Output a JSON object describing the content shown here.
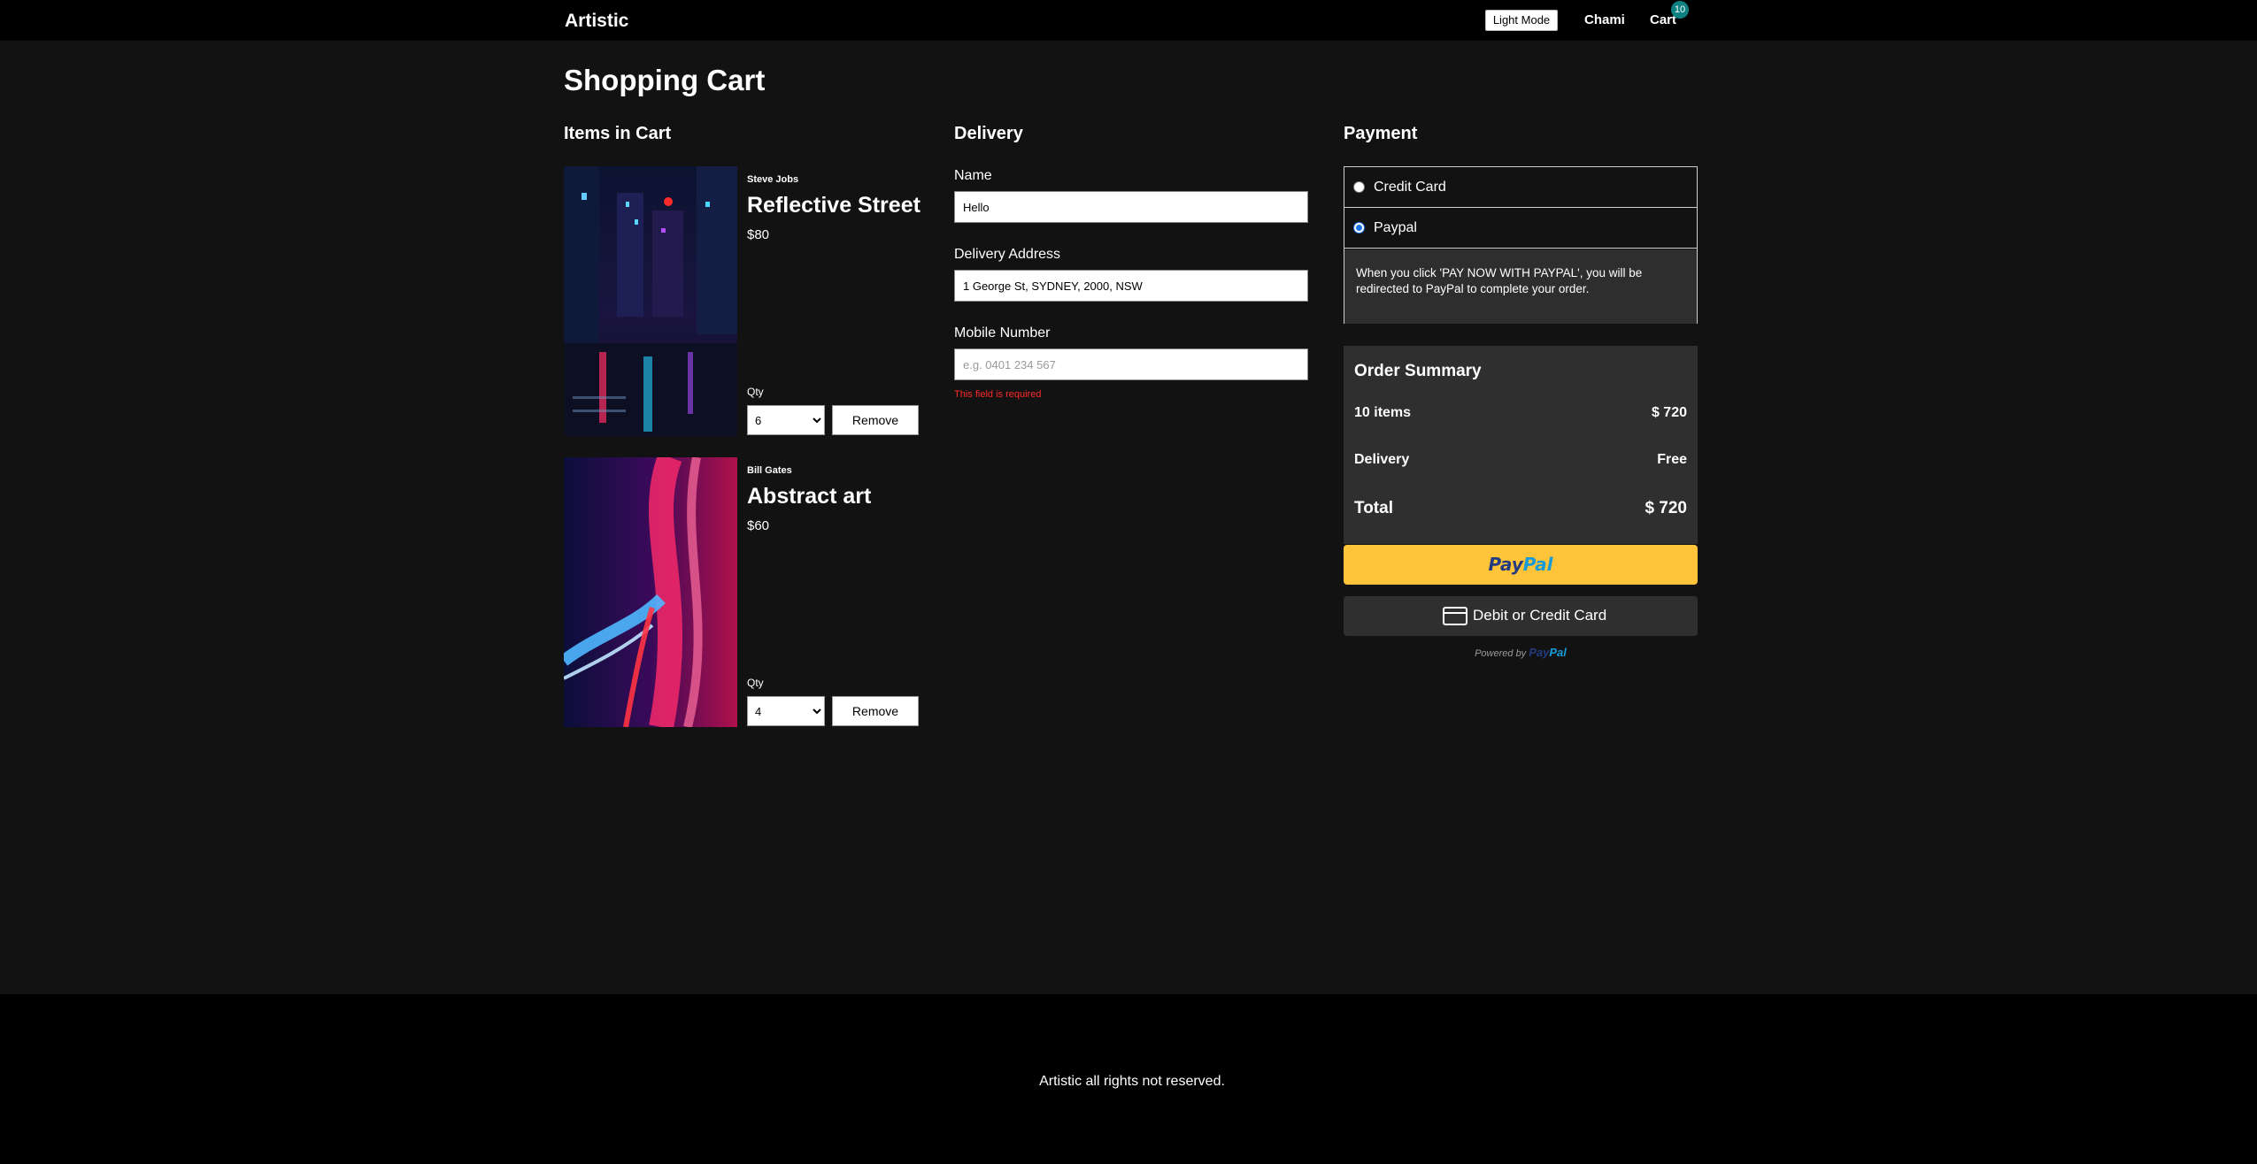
{
  "header": {
    "brand": "Artistic",
    "mode_button": "Light Mode",
    "user": "Chami",
    "cart_label": "Cart",
    "cart_count": "10"
  },
  "page_title": "Shopping Cart",
  "cart": {
    "heading": "Items in Cart",
    "qty_label": "Qty",
    "remove_label": "Remove",
    "items": [
      {
        "artist": "Steve Jobs",
        "title": "Reflective Street",
        "price": "$80",
        "qty": "6"
      },
      {
        "artist": "Bill Gates",
        "title": "Abstract art",
        "price": "$60",
        "qty": "4"
      }
    ]
  },
  "delivery": {
    "heading": "Delivery",
    "name_label": "Name",
    "name_value": "Hello",
    "address_label": "Delivery Address",
    "address_value": "1 George St, SYDNEY, 2000, NSW",
    "mobile_label": "Mobile Number",
    "mobile_value": "",
    "mobile_placeholder": "e.g. 0401 234 567",
    "mobile_error": "This field is required"
  },
  "payment": {
    "heading": "Payment",
    "options": [
      {
        "label": "Credit Card",
        "selected": false
      },
      {
        "label": "Paypal",
        "selected": true
      }
    ],
    "info": "When you click 'PAY NOW WITH PAYPAL', you will be redirected to PayPal to complete your order."
  },
  "summary": {
    "title": "Order Summary",
    "items_label": "10 items",
    "items_value": "$ 720",
    "delivery_label": "Delivery",
    "delivery_value": "Free",
    "total_label": "Total",
    "total_value": "$ 720"
  },
  "paypal": {
    "brand_part1": "Pay",
    "brand_part2": "Pal",
    "card_button": "Debit or Credit Card",
    "powered_by": "Powered by"
  },
  "footer": {
    "text": "Artistic all rights not reserved."
  },
  "colors": {
    "background": "#121212",
    "header_bg": "#000000",
    "badge": "#0e8080",
    "paypal_yellow": "#ffc439",
    "error_red": "#ff2a2a",
    "panel_grey": "#2f2f2f"
  }
}
